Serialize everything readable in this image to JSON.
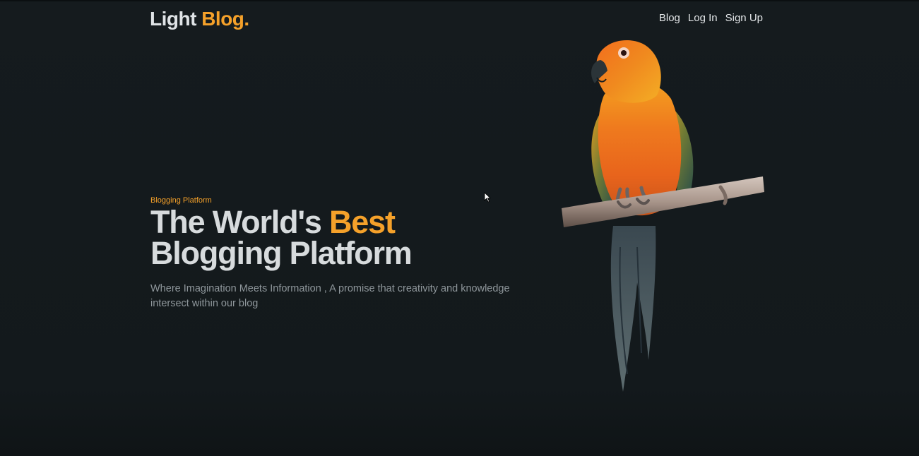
{
  "brand": {
    "name_main": "Light",
    "name_accent": "Blog.",
    "accent_color": "#f5a12a",
    "background_color": "#141a1d"
  },
  "nav": {
    "items": [
      {
        "label": "Blog"
      },
      {
        "label": "Log In"
      },
      {
        "label": "Sign Up"
      }
    ]
  },
  "hero": {
    "eyebrow": "Blogging Platform",
    "headline_part1": "The World's ",
    "headline_accent": "Best",
    "headline_line2": "Blogging Platform",
    "description": "Where Imagination Meets Information , A promise that creativity and knowledge intersect within our blog"
  },
  "image": {
    "subject": "parrot-on-branch"
  }
}
